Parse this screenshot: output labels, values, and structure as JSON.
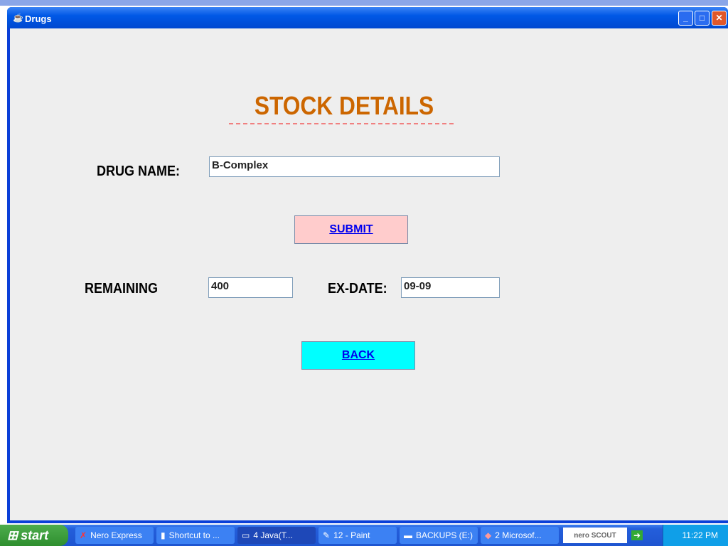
{
  "window": {
    "title": "Drugs",
    "icon": "java-cup-icon"
  },
  "form": {
    "heading": "STOCK DETAILS",
    "drug_name_label": "DRUG NAME:",
    "drug_name_value": "B-Complex",
    "submit_label": "SUBMIT",
    "remaining_label": "REMAINING",
    "remaining_value": "400",
    "exdate_label": "EX-DATE:",
    "exdate_value": "09-09",
    "back_label": "BACK"
  },
  "colors": {
    "heading": "#cc6600",
    "submit_bg": "#ffcccc",
    "back_bg": "#00ffff",
    "link": "#0000ee"
  },
  "taskbar": {
    "start_label": "start",
    "tasks": [
      {
        "label": "Nero Express",
        "icon": "nero-icon"
      },
      {
        "label": "Shortcut to ...",
        "icon": "shortcut-icon"
      },
      {
        "label": "4 Java(T...",
        "icon": "window-icon"
      },
      {
        "label": "12 - Paint",
        "icon": "paint-icon"
      },
      {
        "label": "BACKUPS (E:)",
        "icon": "drive-icon"
      },
      {
        "label": "2 Microsof...",
        "icon": "acrobat-icon"
      }
    ],
    "nero_scout": "nero SCOUT",
    "clock": "11:22 PM"
  }
}
